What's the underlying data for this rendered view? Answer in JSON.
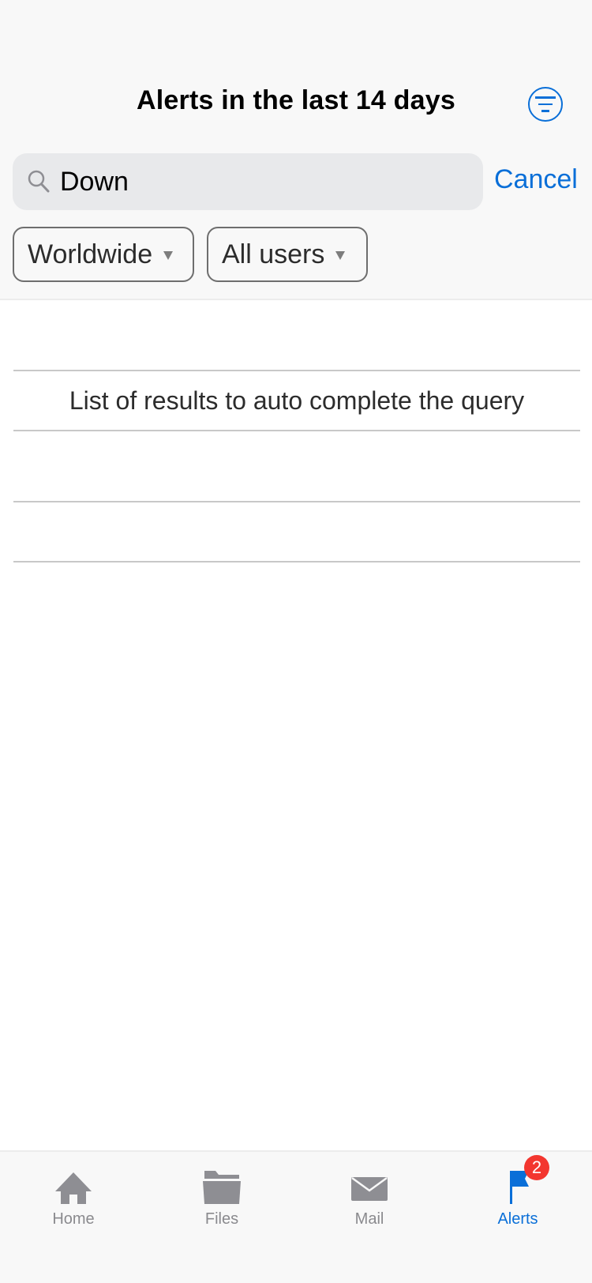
{
  "header": {
    "title": "Alerts in the last 14 days",
    "filter_icon": "filter-icon"
  },
  "search": {
    "icon": "search-icon",
    "value": "Down",
    "placeholder": "Search",
    "cancel_label": "Cancel"
  },
  "filters": {
    "region": {
      "selected": "Worldwide",
      "icon": "caret-down-icon"
    },
    "users": {
      "selected": "All users",
      "icon": "caret-down-icon"
    }
  },
  "results": {
    "rows": [
      {
        "text": ""
      },
      {
        "text": "List of results to auto complete the query"
      },
      {
        "text": ""
      },
      {
        "text": ""
      }
    ]
  },
  "tabbar": {
    "items": [
      {
        "label": "Home",
        "icon": "home-icon",
        "active": false
      },
      {
        "label": "Files",
        "icon": "folder-icon",
        "active": false
      },
      {
        "label": "Mail",
        "icon": "mail-icon",
        "active": false
      },
      {
        "label": "Alerts",
        "icon": "flag-icon",
        "active": true,
        "badge": "2"
      }
    ]
  },
  "colors": {
    "accent": "#0a6fd8",
    "badge": "#f3362f",
    "inactive_tab": "#8a8a8e",
    "header_bg": "#f8f8f8",
    "search_bg": "#e8e9eb"
  }
}
